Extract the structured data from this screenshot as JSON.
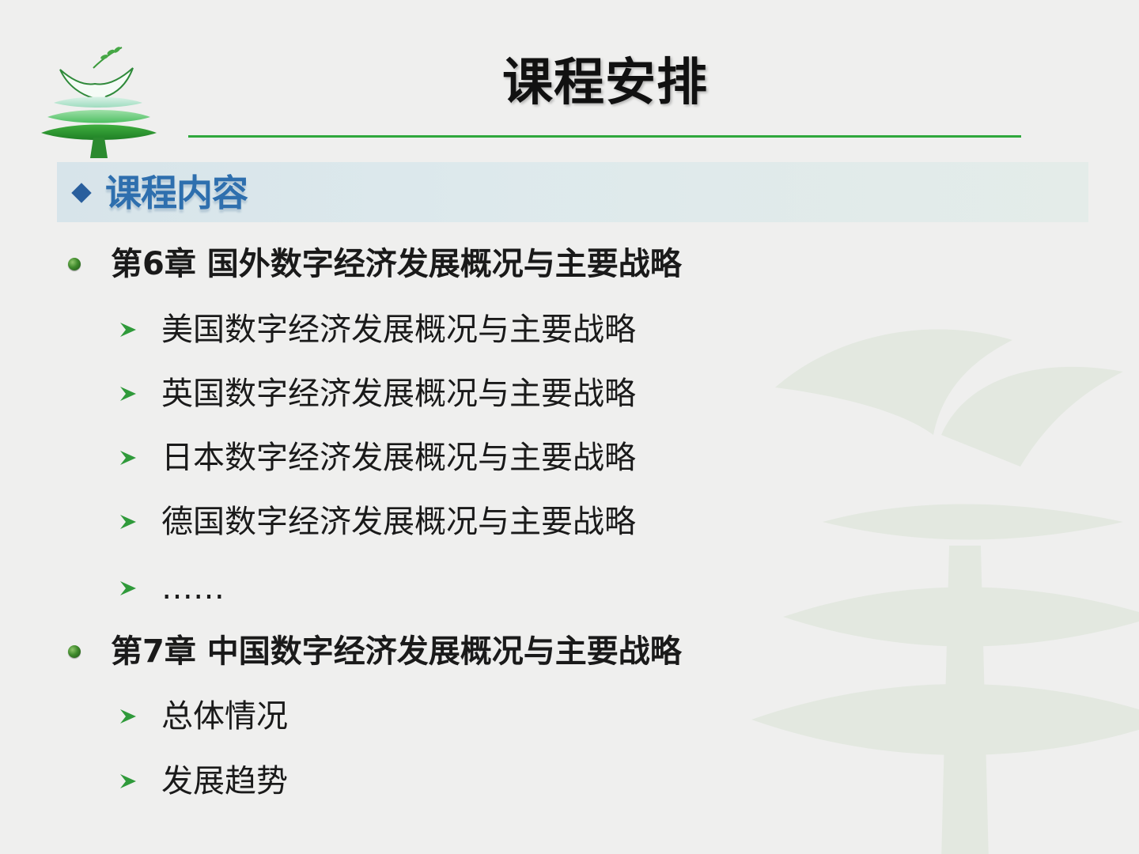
{
  "slide": {
    "title": "课程安排",
    "section": {
      "title": "课程内容",
      "icon": "diamond-bullet-icon"
    },
    "chapters": [
      {
        "label": "第6章  国外数字经济发展概况与主要战略",
        "items": [
          "美国数字经济发展概况与主要战略",
          "英国数字经济发展概况与主要战略",
          "日本数字经济发展概况与主要战略",
          "德国数字经济发展概况与主要战略",
          "……"
        ]
      },
      {
        "label": "第7章  中国数字经济发展概况与主要战略",
        "items": [
          "总体情况",
          "发展趋势"
        ]
      }
    ]
  },
  "colors": {
    "background": "#efefee",
    "accent_green": "#2fa83c",
    "section_blue": "#2e6fae",
    "text": "#1a1a1a"
  }
}
